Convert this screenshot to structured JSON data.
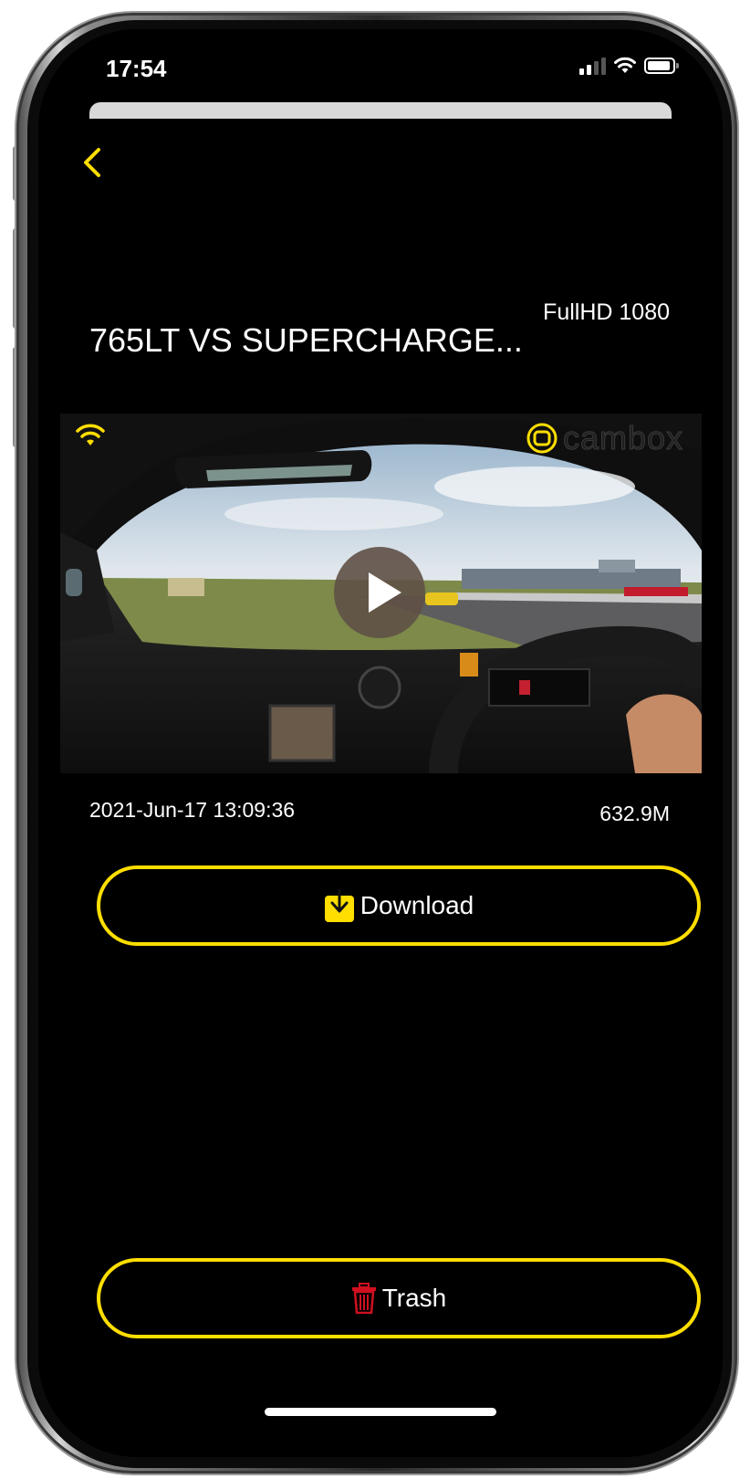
{
  "status_bar": {
    "time": "17:54"
  },
  "video": {
    "title": "765LT VS SUPERCHARGE...",
    "resolution": "FullHD 1080",
    "brand_logo_text": "cambox",
    "date": "2021-Jun-17 13:09:36",
    "size": "632.9M"
  },
  "actions": {
    "download_label": "Download",
    "trash_label": "Trash"
  },
  "icons": {
    "back": "chevron-left-icon",
    "play": "play-icon",
    "wifi": "wifi-icon",
    "download": "download-icon",
    "trash": "trash-icon"
  },
  "colors": {
    "accent": "#ffde00",
    "background": "#000000",
    "trash_icon": "#d01020",
    "text": "#ffffff"
  }
}
